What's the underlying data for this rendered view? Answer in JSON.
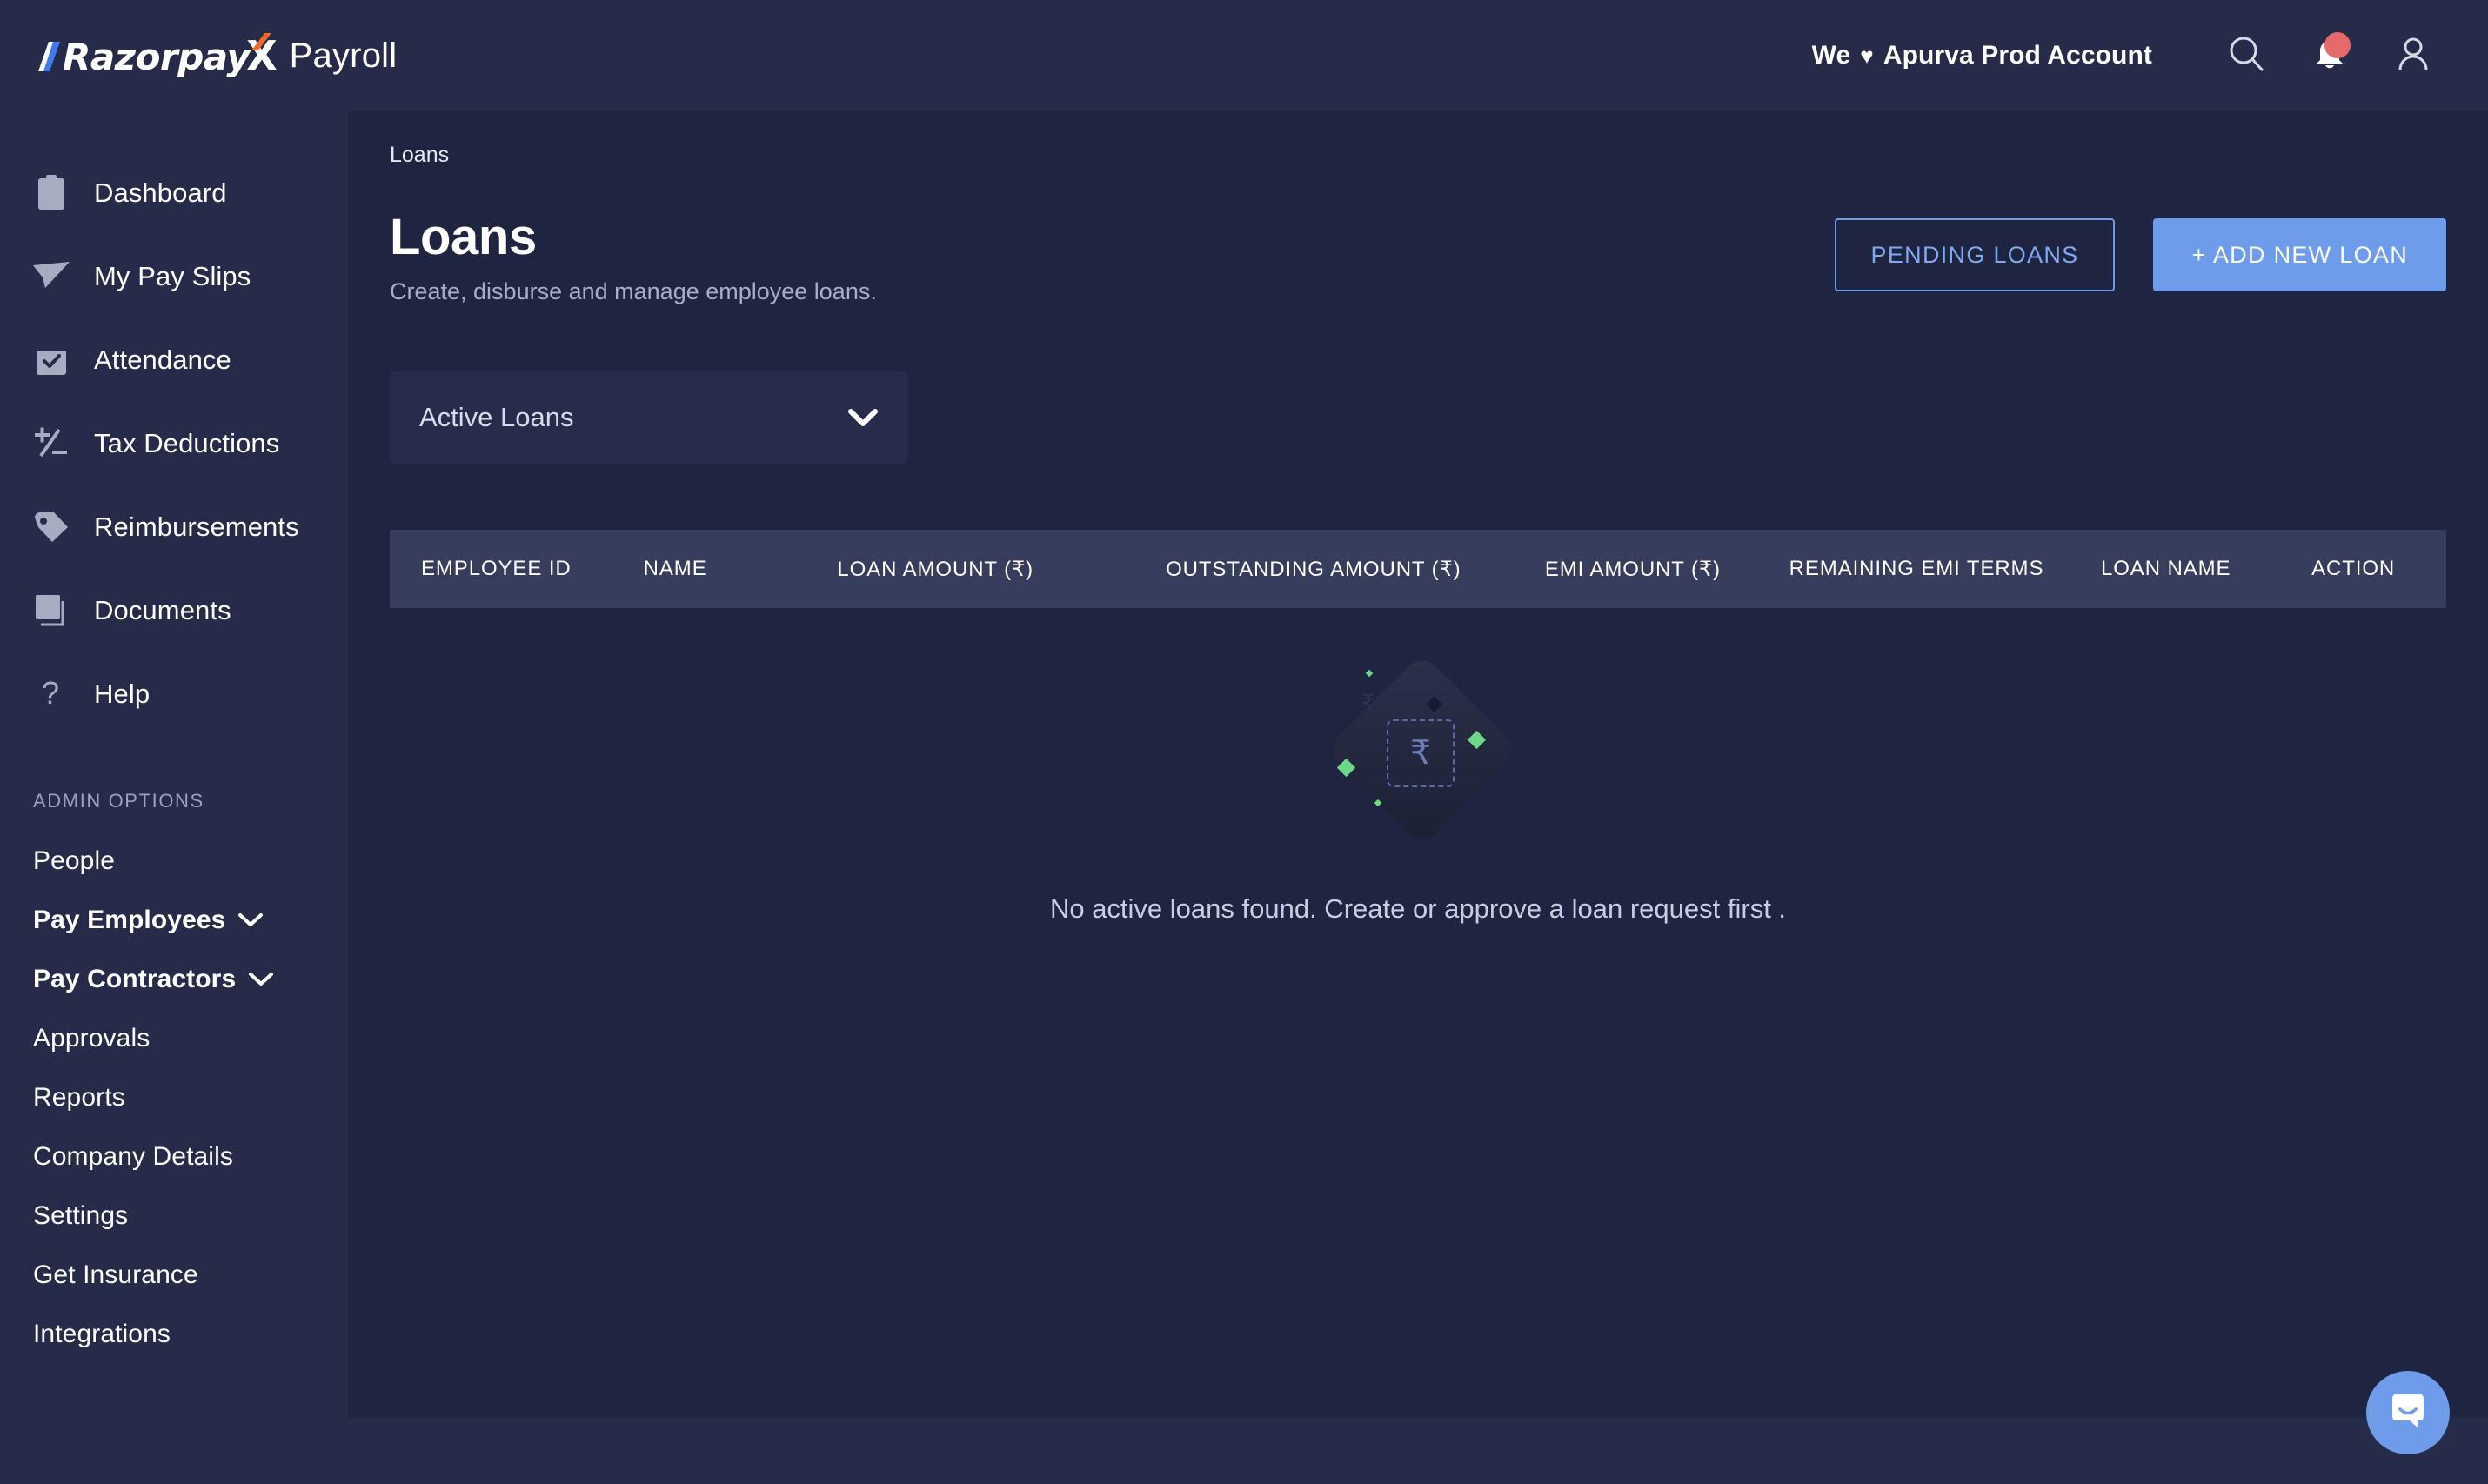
{
  "brand": {
    "name_razorpay": "Razorpay",
    "name_x": "X",
    "product": "Payroll",
    "accent_orange": "#F06B29",
    "accent_blue": "#3E7BF0"
  },
  "topbar": {
    "account_prefix": "We",
    "heart": "♥",
    "account_name": "Apurva Prod Account",
    "search_icon": "search-icon",
    "notifications_icon": "bell-icon",
    "profile_icon": "user-icon",
    "has_notification_badge": true,
    "badge_color": "#E76A6A"
  },
  "sidebar": {
    "items": [
      {
        "label": "Dashboard",
        "icon": "clipboard-icon"
      },
      {
        "label": "My Pay Slips",
        "icon": "paper-plane-icon"
      },
      {
        "label": "Attendance",
        "icon": "calendar-check-icon"
      },
      {
        "label": "Tax Deductions",
        "icon": "plus-minus-icon"
      },
      {
        "label": "Reimbursements",
        "icon": "tag-icon"
      },
      {
        "label": "Documents",
        "icon": "documents-icon"
      },
      {
        "label": "Help",
        "icon": "question-mark-icon"
      }
    ],
    "admin_heading": "ADMIN OPTIONS",
    "admin_items": [
      {
        "label": "People",
        "bold": false,
        "expandable": false
      },
      {
        "label": "Pay Employees",
        "bold": true,
        "expandable": true
      },
      {
        "label": "Pay Contractors",
        "bold": true,
        "expandable": true
      },
      {
        "label": "Approvals",
        "bold": false,
        "expandable": false
      },
      {
        "label": "Reports",
        "bold": false,
        "expandable": false
      },
      {
        "label": "Company Details",
        "bold": false,
        "expandable": false
      },
      {
        "label": "Settings",
        "bold": false,
        "expandable": false
      },
      {
        "label": "Get Insurance",
        "bold": false,
        "expandable": false
      },
      {
        "label": "Integrations",
        "bold": false,
        "expandable": false
      }
    ]
  },
  "main": {
    "breadcrumb": "Loans",
    "title": "Loans",
    "subtitle": "Create, disburse and manage employee loans.",
    "pending_loans_button": "PENDING LOANS",
    "add_new_loan_button": "+ ADD NEW LOAN",
    "filter": {
      "selected": "Active Loans",
      "chevron_icon": "chevron-down-icon"
    },
    "table": {
      "columns": [
        "EMPLOYEE ID",
        "NAME",
        "LOAN AMOUNT (₹)",
        "OUTSTANDING AMOUNT (₹)",
        "EMI AMOUNT (₹)",
        "REMAINING EMI TERMS",
        "LOAN NAME",
        "ACTION"
      ],
      "rows": []
    },
    "empty_state": {
      "message": "No active loans found. Create or approve a loan request first .",
      "illustration": "rupee-empty-box-illustration",
      "rupee_symbol": "₹",
      "accent_green": "#6DD88A"
    }
  },
  "chat": {
    "icon": "intercom-chat-icon",
    "color": "#6E9BEA"
  },
  "colors": {
    "chrome": "#262B4A",
    "content": "#1F2440",
    "table_header": "#373D5C",
    "primary": "#6E9BEA"
  }
}
